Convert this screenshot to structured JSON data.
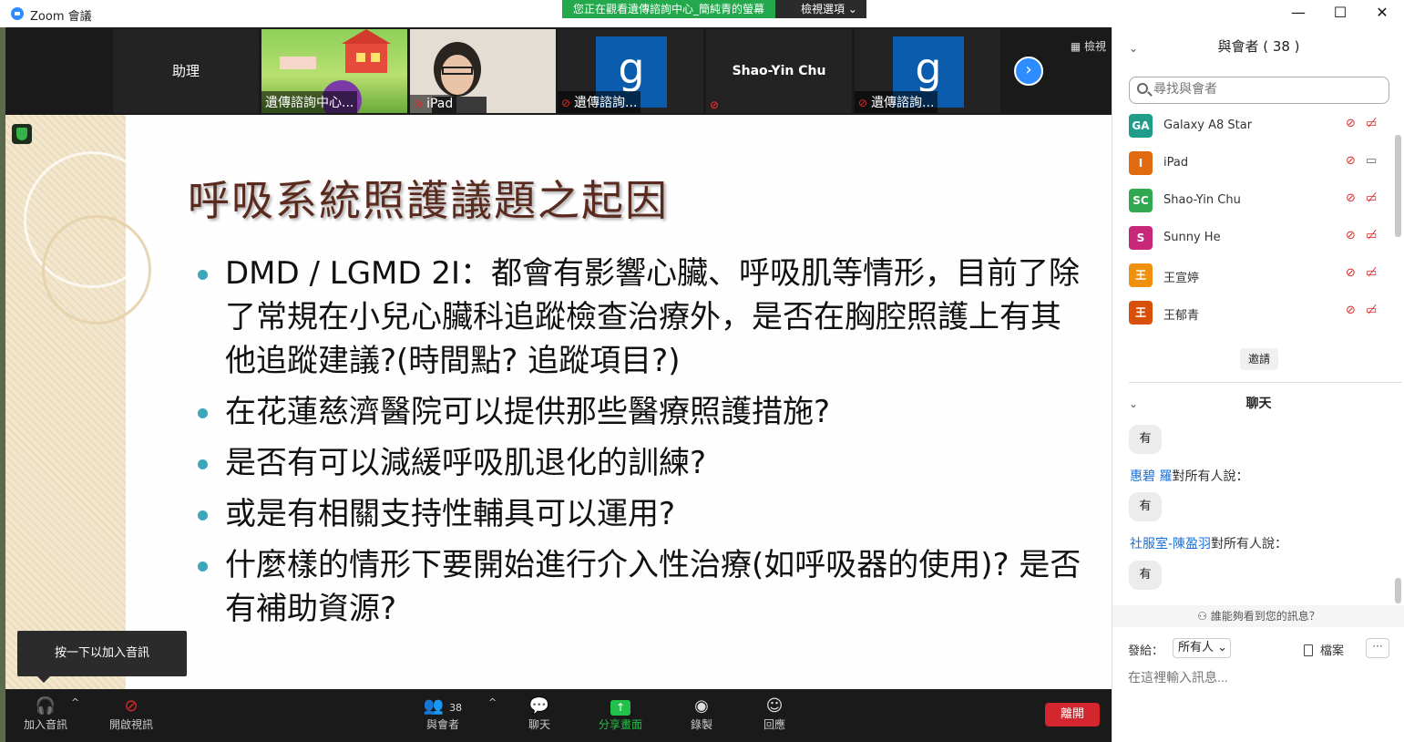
{
  "window": {
    "title": "Zoom 會議",
    "share_notice": "您正在觀看遺傳諮詢中心_簡純青的螢幕",
    "view_options": "檢視選項",
    "minimize": "—",
    "maximize": "☐",
    "close": "✕"
  },
  "video_strip": {
    "tiles": [
      {
        "label": "助理"
      },
      {
        "name": "遺傳諮詢中心..."
      },
      {
        "name": "iPad"
      },
      {
        "name": "遺傳諮詢...",
        "avatar_letter": "g"
      },
      {
        "label": "Shao-Yin Chu"
      },
      {
        "name": "遺傳諮詢...",
        "avatar_letter": "g"
      }
    ],
    "view_label": "檢視",
    "next_icon": "›"
  },
  "slide": {
    "title": "呼吸系統照護議題之起因",
    "bullets": [
      "DMD / LGMD 2I：都會有影響心臟、呼吸肌等情形，目前了除了常規在小兒心臟科追蹤檢查治療外，是否在胸腔照護上有其他追蹤建議?(時間點? 追蹤項目?)",
      "在花蓮慈濟醫院可以提供那些醫療照護措施?",
      "是否有可以減緩呼吸肌退化的訓練?",
      "或是有相關支持性輔具可以運用?",
      "什麼樣的情形下要開始進行介入性治療(如呼吸器的使用)? 是否有補助資源?"
    ]
  },
  "tooltip": "按一下以加入音訊",
  "toolbar": {
    "join_audio": "加入音訊",
    "start_video": "開啟視訊",
    "participants": "與會者",
    "participant_count": "38",
    "chat": "聊天",
    "share": "分享畫面",
    "record": "錄製",
    "reactions": "回應",
    "leave": "離開"
  },
  "participants_panel": {
    "title": "與會者 ( 38 )",
    "search_placeholder": "尋找與會者",
    "list": [
      {
        "initials": "GA",
        "name": "Galaxy A8 Star",
        "color": "#1f9d8a",
        "cam": "off"
      },
      {
        "initials": "I",
        "name": "iPad",
        "color": "#e06a10",
        "cam": "on"
      },
      {
        "initials": "SC",
        "name": "Shao-Yin Chu",
        "color": "#2fa84f",
        "cam": "off"
      },
      {
        "initials": "S",
        "name": "Sunny He",
        "color": "#c8287a",
        "cam": "off"
      },
      {
        "initials": "王",
        "name": "王宣婷",
        "color": "#f0900f",
        "cam": "off"
      },
      {
        "initials": "王",
        "name": "王郁青",
        "color": "#d9500a",
        "cam": "off"
      }
    ],
    "invite": "邀請"
  },
  "chat_panel": {
    "title": "聊天",
    "messages": [
      {
        "text": "有"
      },
      {
        "sender": "惠碧 羅",
        "suffix": "對所有人說：",
        "text": "有"
      },
      {
        "sender": "社服室-陳盈羽",
        "suffix": "對所有人說：",
        "text": "有"
      }
    ],
    "who_can_see": "誰能夠看到您的訊息？",
    "send_to_label": "發給：",
    "send_to_value": "所有人",
    "file_label": "檔案",
    "more": "···",
    "input_placeholder": "在這裡輸入訊息..."
  }
}
